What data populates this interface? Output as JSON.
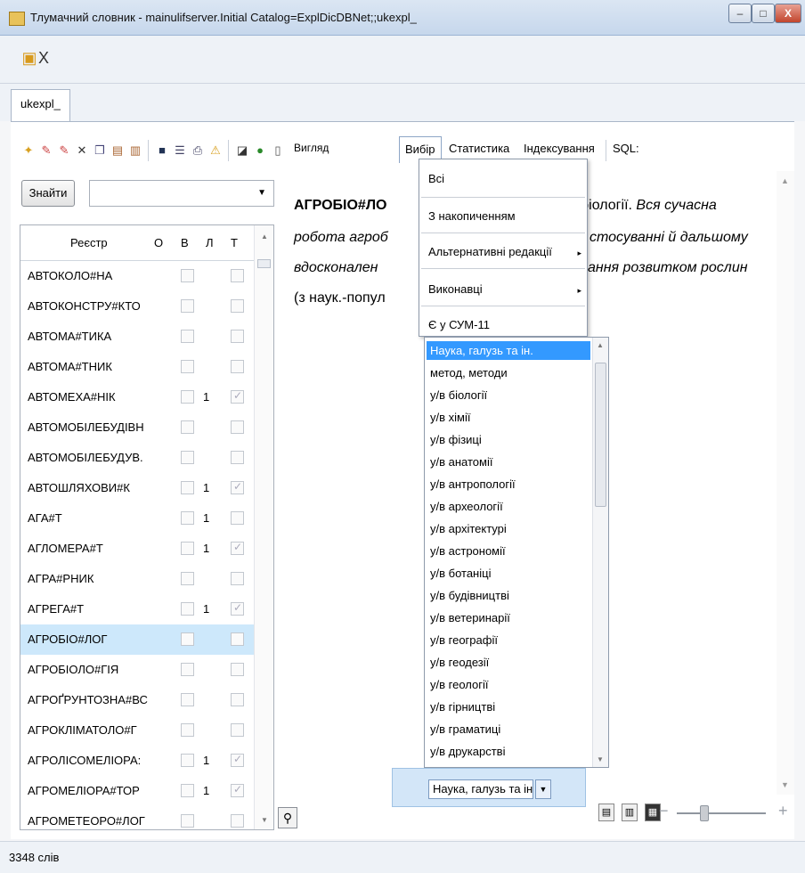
{
  "window": {
    "title": "Тлумачний словник - mainulifserver.Initial Catalog=ExplDicDBNet;;ukexpl_",
    "minimize": "–",
    "maximize": "□",
    "close": "X"
  },
  "top_toolbar": {
    "close_glyph": "X"
  },
  "tabs": [
    "ukexpl_"
  ],
  "menu": {
    "view": "Вигляд",
    "select": "Вибір",
    "stats": "Статистика",
    "indexing": "Індексування",
    "sql": "SQL:"
  },
  "search": {
    "button": "Знайти",
    "value": ""
  },
  "grid": {
    "headers": {
      "registry": "Реєстр",
      "o": "О",
      "v": "В",
      "l": "Л",
      "t": "Т"
    },
    "rows": [
      {
        "name": "АВТОКОЛО#НА",
        "l": "",
        "t_checked": false
      },
      {
        "name": "АВТОКОНСТРУ#КТО",
        "l": "",
        "t_checked": false
      },
      {
        "name": "АВТОМА#ТИКА",
        "l": "",
        "t_checked": false
      },
      {
        "name": "АВТОМА#ТНИК",
        "l": "",
        "t_checked": false
      },
      {
        "name": "АВТОМЕХА#НІК",
        "l": "1",
        "t_checked": true
      },
      {
        "name": "АВТОМОБІЛЕБУДІВН",
        "l": "",
        "t_checked": false
      },
      {
        "name": "АВТОМОБІЛЕБУДУВ.",
        "l": "",
        "t_checked": false
      },
      {
        "name": "АВТОШЛЯХОВИ#К",
        "l": "1",
        "t_checked": true
      },
      {
        "name": "АГА#Т",
        "l": "1",
        "t_checked": false
      },
      {
        "name": "АГЛОМЕРА#Т",
        "l": "1",
        "t_checked": true
      },
      {
        "name": "АГРА#РНИК",
        "l": "",
        "t_checked": false
      },
      {
        "name": "АГРЕГА#Т",
        "l": "1",
        "t_checked": true
      },
      {
        "name": "АГРОБІО#ЛОГ",
        "l": "",
        "t_checked": false,
        "selected": true
      },
      {
        "name": "АГРОБІОЛО#ГІЯ",
        "l": "",
        "t_checked": false
      },
      {
        "name": "АГРОҐРУНТОЗНА#ВС",
        "l": "",
        "t_checked": false
      },
      {
        "name": "АГРОКЛІМАТОЛО#Г",
        "l": "",
        "t_checked": false
      },
      {
        "name": "АГРОЛІСОМЕЛІОРА:",
        "l": "1",
        "t_checked": true
      },
      {
        "name": "АГРОМЕЛІОРА#ТОР",
        "l": "1",
        "t_checked": true
      },
      {
        "name": "АГРОМЕТЕОРО#ЛОГ",
        "l": "",
        "t_checked": false
      }
    ]
  },
  "article": {
    "line1_bold": "АГРОБІО#ЛО",
    "line1_rest": "біології.",
    "line1_italic": "Вся сучасна",
    "line2_a": "робота агроб",
    "line2_b": "стосуванні й дальшому",
    "line3_a": "вдосконален",
    "line3_b": "ання розвитком рослин",
    "line4": "(з наук.-попул"
  },
  "dropdown": {
    "items": [
      "Всі",
      "З накопиченням",
      "Альтернативні редакції",
      "Виконавці",
      "Є у СУМ-11"
    ],
    "submenu_arrow": "▸"
  },
  "listbox": {
    "items": [
      "Наука, галузь та ін.",
      "метод, методи",
      "у/в біології",
      "у/в хімії",
      "у/в фізиці",
      "у/в анатомії",
      "у/в антропології",
      "у/в археології",
      "у/в архітектурі",
      "у/в астрономії",
      "у/в ботаніці",
      "у/в будівництві",
      "у/в ветеринарії",
      "у/в географії",
      "у/в геодезії",
      "у/в геології",
      "у/в гірництві",
      "у/в граматиці",
      "у/в друкарстві"
    ]
  },
  "combo_selected": "Наука, галузь та ін.",
  "status": {
    "words": "3348 слів"
  }
}
